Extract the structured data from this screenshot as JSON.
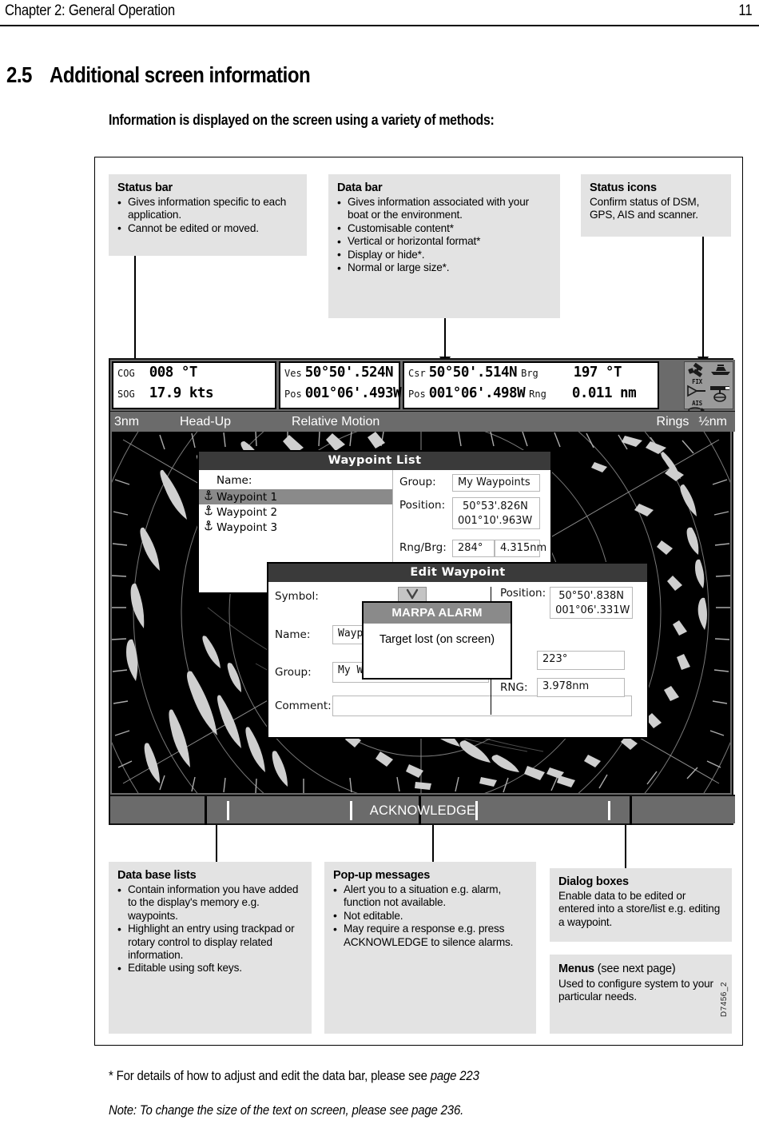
{
  "header": {
    "chapter": "Chapter 2: General Operation",
    "page_number": "11"
  },
  "section": {
    "number": "2.5",
    "title": "Additional screen information",
    "intro": "Information is displayed on the screen using a variety of methods:"
  },
  "callouts": {
    "status_bar": {
      "title": "Status bar",
      "items": [
        "Gives information specific to each application.",
        "Cannot be edited or moved."
      ]
    },
    "data_bar": {
      "title": "Data bar",
      "items": [
        "Gives information associated with your boat or the environment.",
        "Customisable content*",
        "Vertical or horizontal format*",
        "Display or hide*.",
        "Normal or large size*."
      ]
    },
    "status_icons": {
      "title": "Status icons",
      "body": "Confirm status of DSM, GPS, AIS and scanner."
    },
    "database_lists": {
      "title": "Data base lists",
      "items": [
        "Contain information you have added to the display's memory e.g. waypoints.",
        "Highlight an entry using trackpad or rotary control to display related information.",
        "Editable using soft keys."
      ]
    },
    "popup_messages": {
      "title": "Pop-up messages",
      "items": [
        "Alert you to a situation e.g. alarm, function not available.",
        "Not editable.",
        "May require a response e.g. press ACKNOWLEDGE to silence alarms."
      ]
    },
    "dialog_boxes": {
      "title": "Dialog boxes",
      "body": "Enable data to be edited or entered into a store/list e.g. editing a waypoint."
    },
    "menus": {
      "title": "Menus",
      "title_suffix": " (see next page)",
      "body": "Used to configure system to your particular needs."
    }
  },
  "device": {
    "data_bar": {
      "cells": [
        {
          "rows": [
            {
              "label": "COG",
              "value": "008 °T"
            },
            {
              "label": "SOG",
              "value": "17.9 kts"
            }
          ]
        },
        {
          "rows": [
            {
              "label": "Ves",
              "value": "50°50'.524N"
            },
            {
              "label": "Pos",
              "value": "001°06'.493W"
            }
          ]
        },
        {
          "rows": [
            {
              "label": "Csr",
              "value": "50°50'.514N",
              "label2": "Brg",
              "value2": "197 °T"
            },
            {
              "label": "Pos",
              "value": "001°06'.498W",
              "label2": "Rng",
              "value2": "0.011 nm"
            }
          ]
        }
      ]
    },
    "status_icons": [
      {
        "name": "gps-fix-icon",
        "caption": "FIX"
      },
      {
        "name": "boat-icon",
        "caption": ""
      },
      {
        "name": "ais-icon",
        "caption": "AIS"
      },
      {
        "name": "scanner-icon",
        "caption": ""
      },
      {
        "name": "fish-icon",
        "caption": ""
      },
      {
        "name": "dsm-transducer-icon",
        "caption": ""
      }
    ],
    "status_bar": {
      "range": "3nm",
      "orientation": "Head-Up",
      "motion": "Relative Motion",
      "rings_label": "Rings",
      "rings_value": "½nm"
    },
    "softkeys": {
      "acknowledge": "ACKNOWLEDGE"
    }
  },
  "dialogs": {
    "waypoint_list": {
      "title": "Waypoint List",
      "name_header": "Name:",
      "items": [
        {
          "label": "Waypoint 1",
          "selected": true
        },
        {
          "label": "Waypoint 2",
          "selected": false
        },
        {
          "label": "Waypoint 3",
          "selected": false
        }
      ],
      "group_label": "Group:",
      "group_value": "My Waypoints",
      "position_label": "Position:",
      "position_value_1": "50°53'.826N",
      "position_value_2": "001°10'.963W",
      "rngbrg_label": "Rng/Brg:",
      "rng_value": "284°",
      "brg_value": "4.315nm"
    },
    "edit_waypoint": {
      "title": "Edit Waypoint",
      "symbol_label": "Symbol:",
      "symbol_glyph": "crossed-anchor-icon",
      "name_label": "Name:",
      "name_value": "Waypoint",
      "group_label": "Group:",
      "group_value": "My Way",
      "comment_label": "Comment:",
      "comment_value": "",
      "position_label": "Position:",
      "position_value_1": "50°50'.838N",
      "position_value_2": "001°06'.331W",
      "brg_label": "G:",
      "brg_value": "223°",
      "rng_label": "RNG:",
      "rng_value": "3.978nm"
    },
    "marpa_alarm": {
      "title": "MARPA ALARM",
      "body": "Target lost (on screen)"
    }
  },
  "footnotes": {
    "line1_plain": "* For details of how to adjust and edit the data bar, please see ",
    "line1_italic": "page 223",
    "line2": "Note: To change the size of the text on screen, please see page 236."
  },
  "figure_id": "D7456_2",
  "colors": {
    "callout_bg": "#e3e3e3",
    "device_chrome": "#6b6b6b",
    "dialog_title": "#3a3a3a",
    "selection": "#8a8a8a",
    "radar_bg": "#000000",
    "radar_echo": "#d0d0d0"
  }
}
